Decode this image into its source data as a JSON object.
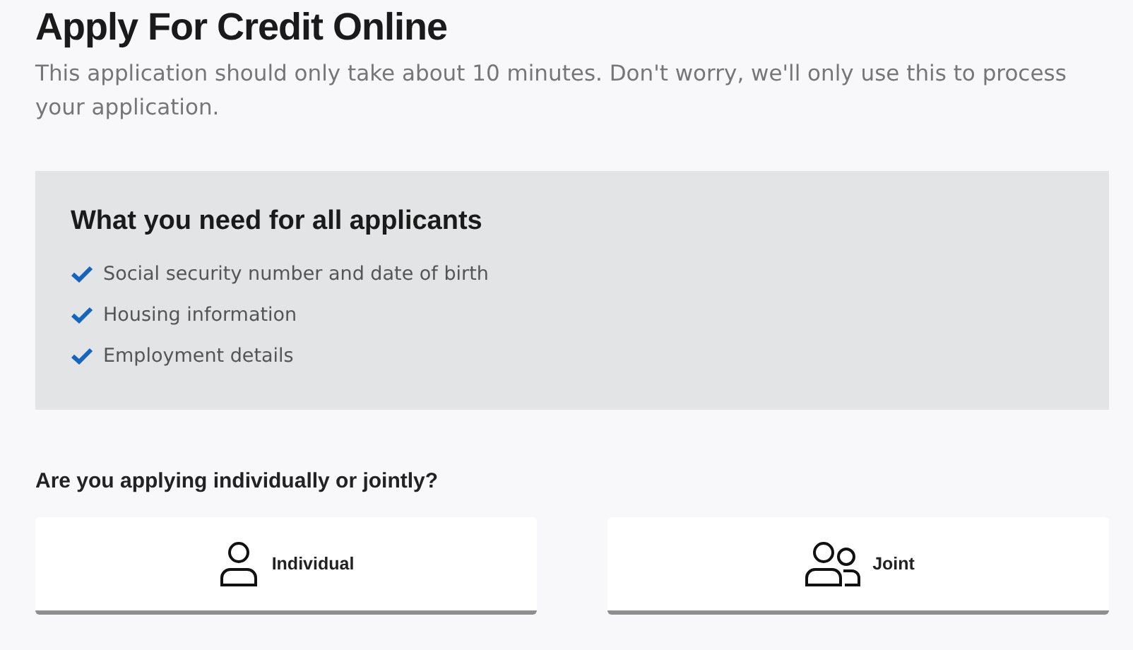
{
  "title": "Apply For Credit Online",
  "intro": "This application should only take about 10 minutes. Don't worry, we'll only use this to process your application.",
  "requirements": {
    "heading": "What you need for all applicants",
    "items": [
      {
        "text": "Social security number and date of birth"
      },
      {
        "text": "Housing information"
      },
      {
        "text": "Employment details"
      }
    ]
  },
  "question": "Are you applying individually or jointly?",
  "options": [
    {
      "kind": "individual",
      "label": "Individual"
    },
    {
      "kind": "joint",
      "label": "Joint"
    }
  ]
}
